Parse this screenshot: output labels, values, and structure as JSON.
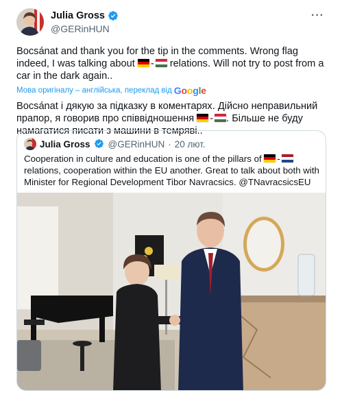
{
  "tweet": {
    "display_name": "Julia Gross",
    "handle": "@GERinHUN",
    "more_icon": "more-icon",
    "text_part1": "Bocsánat and thank you for the tip in the comments. Wrong flag indeed, I was talking about",
    "text_part2": "relations. Will not try to post from a car in the dark again..",
    "translate_label": "Мова оригіналу – англійська, переклад від",
    "translate_brand": "Google",
    "translated_part1": "Bocsánat і дякую за підказку в коментарях. Дійсно неправильний прапор, я говорив про співвідношення",
    "translated_part2": ". Більше не буду намагатися писати з машини в темряві..",
    "dash": "-"
  },
  "quote": {
    "display_name": "Julia Gross",
    "handle": "@GERinHUN",
    "separator": "·",
    "date": "20 лют.",
    "text_part1": "Cooperation in culture and education is one of the pillars of",
    "text_part2": "relations, cooperation within the EU another. Great to talk about both with Minister for Regional Development Tibor Navracsics. @TNavracsicsEU"
  },
  "colors": {
    "accent": "#1d9bf0",
    "secondary_text": "#536471",
    "border": "#cfd9de",
    "flag_de": [
      "#000000",
      "#dd0000",
      "#ffce00"
    ],
    "flag_hu": [
      "#ce2939",
      "#ffffff",
      "#477050"
    ],
    "flag_nl": [
      "#ae1c28",
      "#ffffff",
      "#21468b"
    ]
  }
}
